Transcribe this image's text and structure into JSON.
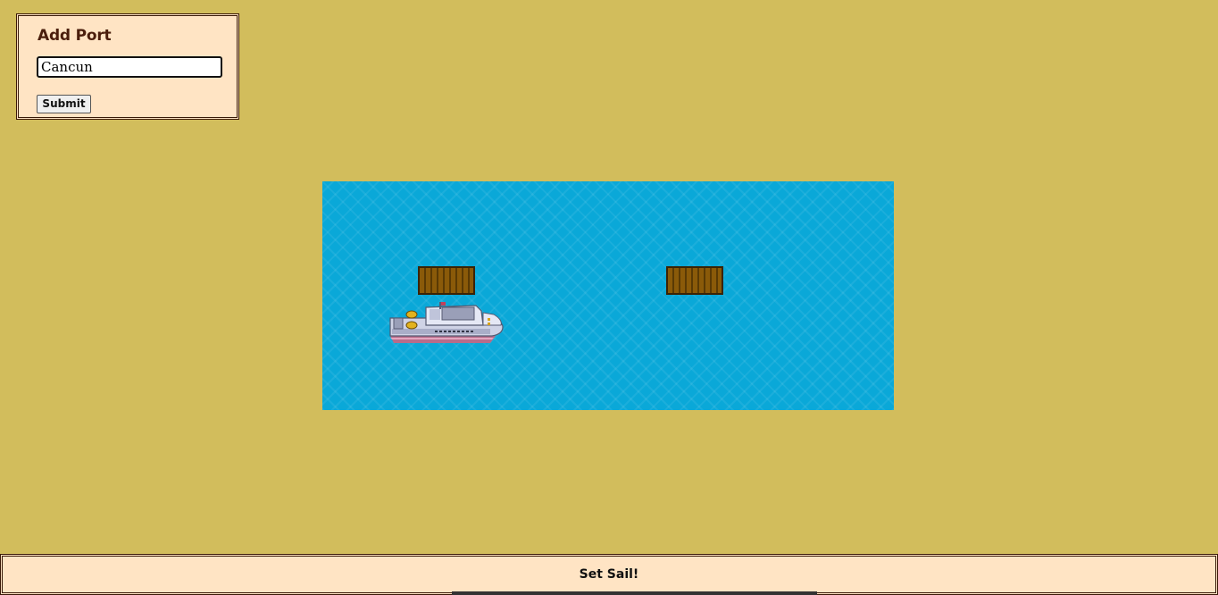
{
  "add_port": {
    "title": "Add Port",
    "input_value": "Cancun",
    "submit_label": "Submit"
  },
  "map": {
    "docks": [
      "dock",
      "dock"
    ],
    "ship": "ship"
  },
  "footer": {
    "set_sail_label": "Set Sail!"
  },
  "colors": {
    "background": "#d2bd5c",
    "sea": "#0aa8d8",
    "panel": "#ffe4c4",
    "dock": "#8a5a09"
  }
}
